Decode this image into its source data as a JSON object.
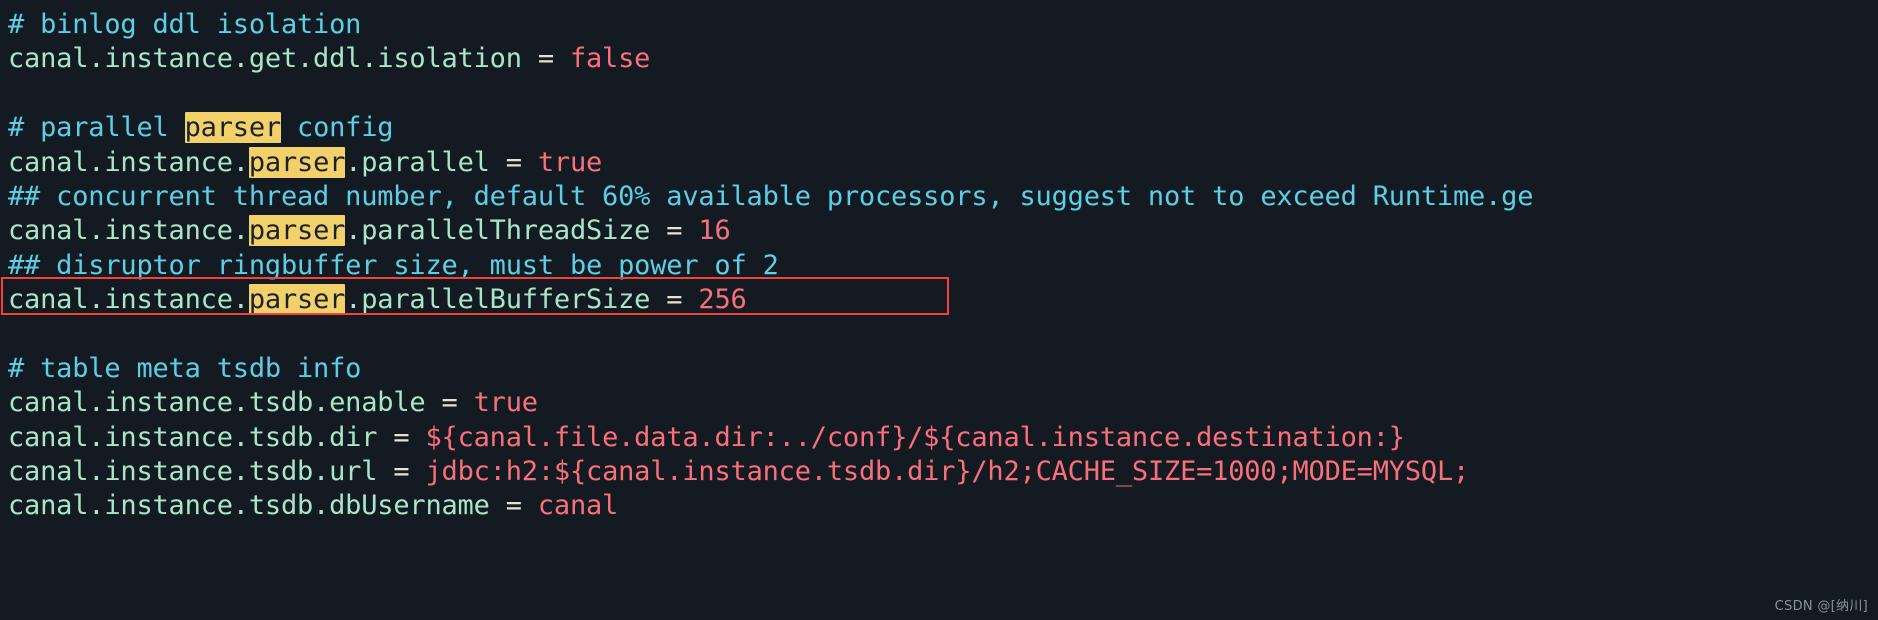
{
  "editor": {
    "background_color": "#131a21",
    "comment_color": "#5ccfe6",
    "key_color": "#a9e5c8",
    "operator_color": "#e6e1d4",
    "value_color": "#f9707a",
    "highlight_color": "#f2d16b",
    "annotation_color": "#f2423a",
    "search_term": "parser"
  },
  "watermark": {
    "text": "CSDN @[纳川]"
  },
  "annotation": {
    "type": "red-rectangle",
    "target_line_index": 6,
    "label": "canal.instance.parser.parallelThreadSize = 16"
  },
  "lines": [
    {
      "index": 0,
      "kind": "comment",
      "text": "# binlog ddl isolation",
      "parts": [
        {
          "type": "comment",
          "text": "# binlog ddl isolation"
        }
      ]
    },
    {
      "index": 1,
      "kind": "property",
      "text": "canal.instance.get.ddl.isolation = false",
      "parts": [
        {
          "type": "key",
          "text": "canal.instance.get.ddl.isolation "
        },
        {
          "type": "eq",
          "text": "="
        },
        {
          "type": "val",
          "text": " false"
        }
      ]
    },
    {
      "index": 2,
      "kind": "blank",
      "text": "",
      "parts": []
    },
    {
      "index": 3,
      "kind": "comment",
      "text": "# parallel parser config",
      "parts": [
        {
          "type": "comment",
          "text": "# parallel "
        },
        {
          "type": "comment",
          "text": "parser",
          "highlight": true
        },
        {
          "type": "comment",
          "text": " config"
        }
      ]
    },
    {
      "index": 4,
      "kind": "property",
      "text": "canal.instance.parser.parallel = true",
      "parts": [
        {
          "type": "key",
          "text": "canal.instance."
        },
        {
          "type": "key",
          "text": "parser",
          "highlight": true
        },
        {
          "type": "key",
          "text": ".parallel "
        },
        {
          "type": "eq",
          "text": "="
        },
        {
          "type": "val",
          "text": " true"
        }
      ]
    },
    {
      "index": 5,
      "kind": "comment",
      "text": "## concurrent thread number, default 60% available processors, suggest not to exceed Runtime.ge",
      "parts": [
        {
          "type": "comment",
          "text": "## concurrent thread number, default 60% available processors, suggest not to exceed Runtime.ge"
        }
      ]
    },
    {
      "index": 6,
      "kind": "property",
      "text": "canal.instance.parser.parallelThreadSize = 16",
      "parts": [
        {
          "type": "key",
          "text": "canal.instance."
        },
        {
          "type": "key",
          "text": "parser",
          "highlight": true
        },
        {
          "type": "key",
          "text": ".parallelThreadSize "
        },
        {
          "type": "eq",
          "text": "="
        },
        {
          "type": "val",
          "text": " 16"
        }
      ]
    },
    {
      "index": 7,
      "kind": "comment",
      "text": "## disruptor ringbuffer size, must be power of 2",
      "parts": [
        {
          "type": "comment",
          "text": "## disruptor ringbuffer size, must be power of 2"
        }
      ]
    },
    {
      "index": 8,
      "kind": "property",
      "text": "canal.instance.parser.parallelBufferSize = 256",
      "parts": [
        {
          "type": "key",
          "text": "canal.instance."
        },
        {
          "type": "key",
          "text": "parser",
          "highlight": true
        },
        {
          "type": "key",
          "text": ".parallelBufferSize "
        },
        {
          "type": "eq",
          "text": "="
        },
        {
          "type": "val",
          "text": " 256"
        }
      ]
    },
    {
      "index": 9,
      "kind": "blank",
      "text": "",
      "parts": []
    },
    {
      "index": 10,
      "kind": "comment",
      "text": "# table meta tsdb info",
      "parts": [
        {
          "type": "comment",
          "text": "# table meta tsdb info"
        }
      ]
    },
    {
      "index": 11,
      "kind": "property",
      "text": "canal.instance.tsdb.enable = true",
      "parts": [
        {
          "type": "key",
          "text": "canal.instance.tsdb.enable "
        },
        {
          "type": "eq",
          "text": "="
        },
        {
          "type": "val",
          "text": " true"
        }
      ]
    },
    {
      "index": 12,
      "kind": "property",
      "text": "canal.instance.tsdb.dir = ${canal.file.data.dir:../conf}/${canal.instance.destination:}",
      "parts": [
        {
          "type": "key",
          "text": "canal.instance.tsdb.dir "
        },
        {
          "type": "eq",
          "text": "="
        },
        {
          "type": "val",
          "text": " ${canal.file.data.dir:../conf}/${canal.instance.destination:}"
        }
      ]
    },
    {
      "index": 13,
      "kind": "property",
      "text": "canal.instance.tsdb.url = jdbc:h2:${canal.instance.tsdb.dir}/h2;CACHE_SIZE=1000;MODE=MYSQL;",
      "parts": [
        {
          "type": "key",
          "text": "canal.instance.tsdb.url "
        },
        {
          "type": "eq",
          "text": "="
        },
        {
          "type": "val",
          "text": " jdbc:h2:${canal.instance.tsdb.dir}/h2;CACHE_SIZE=1000;MODE=MYSQL;"
        }
      ]
    },
    {
      "index": 14,
      "kind": "property",
      "text": "canal.instance.tsdb.dbUsername = canal",
      "clipped": true,
      "parts": [
        {
          "type": "key",
          "text": "canal.instance.tsdb.dbUsername "
        },
        {
          "type": "eq",
          "text": "="
        },
        {
          "type": "val",
          "text": " canal"
        }
      ]
    }
  ]
}
